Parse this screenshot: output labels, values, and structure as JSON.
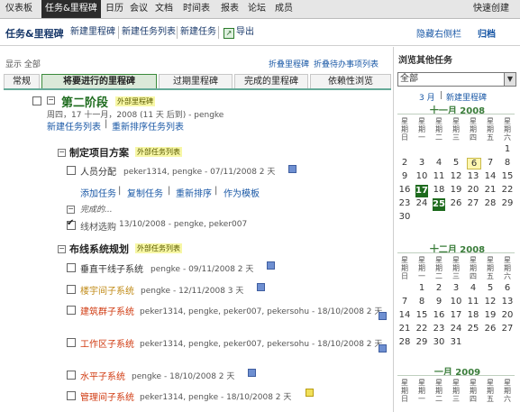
{
  "topnav": {
    "items": [
      "仪表板",
      "任务&里程碑",
      "日历",
      "会议",
      "文档",
      "时间表",
      "报表",
      "论坛",
      "成员"
    ],
    "quick_create": "快速创建"
  },
  "section": {
    "title": "任务&里程碑",
    "buttons": [
      "新建里程碑",
      "新建任务列表",
      "新建任务",
      "导出"
    ],
    "hide_sidebar": "隐藏右侧栏",
    "archive": "归档"
  },
  "show_all": "显示 全部",
  "top_links": [
    "折叠里程碑",
    "折叠待办事项列表"
  ],
  "tabs": [
    "常规",
    "将要进行的里程碑",
    "过期里程碑",
    "完成的里程碑",
    "依赖性浏览"
  ],
  "milestone": {
    "title": "第二阶段",
    "badge": "外部里程碑",
    "meta": "周四，17 十一月，2008 (11 天 后到) - pengke",
    "links": [
      "新建任务列表",
      "重新排序任务列表"
    ]
  },
  "lists": [
    {
      "name": "制定项目方案",
      "badge": "外部任务列表",
      "tasks": [
        {
          "name": "人员分配",
          "meta": "peker1314, pengke - 07/11/2008 2 天"
        }
      ],
      "actions": [
        "添加任务",
        "复制任务",
        "重新排序",
        "作为模板"
      ],
      "completed_label": "完成的...",
      "completed": [
        {
          "name": "线材选购",
          "meta": "13/10/2008  - pengke, peker007"
        }
      ]
    },
    {
      "name": "布线系统规划",
      "badge": "外部任务列表",
      "tasks": [
        {
          "name": "垂直干线子系统",
          "meta": "pengke  - 09/11/2008 2 天"
        },
        {
          "name": "楼宇间子系统",
          "meta": "pengke  - 12/11/2008 3 天"
        },
        {
          "name": "建筑群子系统",
          "meta": "peker1314, pengke, peker007, pekersohu  - 18/10/2008 2 天"
        },
        {
          "name": "工作区子系统",
          "meta": "peker1314, pengke, peker007, pekersohu  - 18/10/2008 2 天"
        },
        {
          "name": "水平子系统",
          "meta": "pengke  - 18/10/2008 2 天"
        },
        {
          "name": "管理间子系统",
          "meta": "peker1314, pengke  - 18/10/2008 2 天"
        }
      ]
    }
  ],
  "sidebar": {
    "title": "浏览其他任务",
    "select_value": "全部",
    "links": [
      "3 月",
      "新建里程碑"
    ],
    "dow": [
      "星期日",
      "星期一",
      "星期二",
      "星期三",
      "星期四",
      "星期五",
      "星期六"
    ],
    "calendars": [
      {
        "month": "十一月 2008",
        "rows": [
          [
            "",
            "",
            "",
            "",
            "",
            "",
            "1"
          ],
          [
            "2",
            "3",
            "4",
            "5",
            "6",
            "7",
            "8"
          ],
          [
            "9",
            "10",
            "11",
            "12",
            "13",
            "14",
            "15"
          ],
          [
            "16",
            "17",
            "18",
            "19",
            "20",
            "21",
            "22"
          ],
          [
            "23",
            "24",
            "25",
            "26",
            "27",
            "28",
            "29"
          ],
          [
            "30",
            "",
            "",
            "",
            "",
            "",
            ""
          ]
        ]
      },
      {
        "month": "十二月 2008",
        "rows": [
          [
            "",
            "1",
            "2",
            "3",
            "4",
            "5",
            "6"
          ],
          [
            "7",
            "8",
            "9",
            "10",
            "11",
            "12",
            "13"
          ],
          [
            "14",
            "15",
            "16",
            "17",
            "18",
            "19",
            "20"
          ],
          [
            "21",
            "22",
            "23",
            "24",
            "25",
            "26",
            "27"
          ],
          [
            "28",
            "29",
            "30",
            "31",
            "",
            "",
            ""
          ]
        ]
      },
      {
        "month": "一月 2009",
        "rows": []
      }
    ]
  }
}
